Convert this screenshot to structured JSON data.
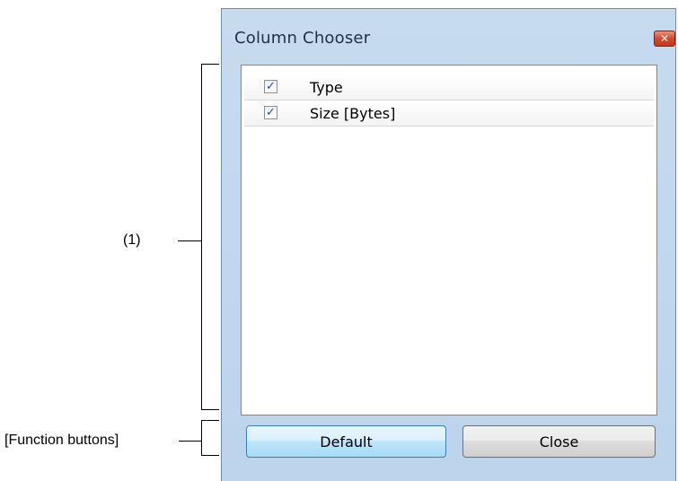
{
  "annotations": {
    "list_marker": "(1)",
    "buttons_marker": "[Function buttons]"
  },
  "dialog": {
    "title": "Column Chooser",
    "close_glyph": "✕",
    "items": [
      {
        "label": "Type",
        "checked": true
      },
      {
        "label": "Size [Bytes]",
        "checked": true
      }
    ],
    "default_button": "Default",
    "close_button": "Close"
  },
  "colors": {
    "frame": "#bcd4ec",
    "close_button": "#d4492c",
    "default_button_border": "#3c7fb1"
  },
  "icons": {
    "close": "close-icon",
    "check": "checkmark-icon"
  }
}
